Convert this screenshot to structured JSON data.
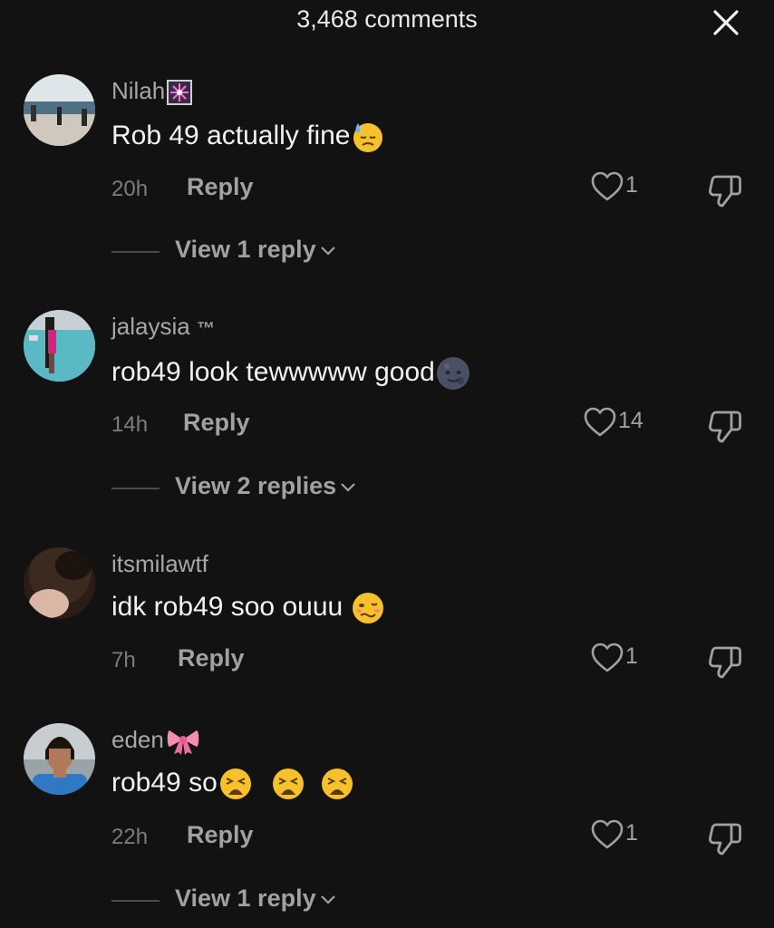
{
  "header": {
    "title": "3,468 comments",
    "close_icon": "close-icon"
  },
  "colors": {
    "background": "#121212",
    "username": "#a7a7a7",
    "text": "#f2f2f2",
    "muted": "#7d7d7d",
    "action": "#a1a1a1"
  },
  "comments": [
    {
      "username": "Nilah",
      "badge": "sparkler-emoji",
      "text": "Rob 49 actually fine",
      "emoji": "downcast-face-with-sweat-emoji",
      "time": "20h",
      "reply_label": "Reply",
      "likes": "1",
      "view_replies": "View 1 reply"
    },
    {
      "username": "jalaysia",
      "badge": "™",
      "text": "rob49 look tewwwww good",
      "emoji": "new-moon-face-emoji",
      "time": "14h",
      "reply_label": "Reply",
      "likes": "14",
      "view_replies": "View 2 replies"
    },
    {
      "username": "itsmilawtf",
      "badge": "",
      "text": "idk rob49 soo ouuu",
      "emoji": "woozy-face-emoji",
      "time": "7h",
      "reply_label": "Reply",
      "likes": "1",
      "view_replies": ""
    },
    {
      "username": "eden",
      "badge": "ribbon-emoji",
      "text": "rob49 so",
      "emoji": "weary-face-emoji",
      "time": "22h",
      "reply_label": "Reply",
      "likes": "1",
      "view_replies": "View 1 reply"
    }
  ]
}
